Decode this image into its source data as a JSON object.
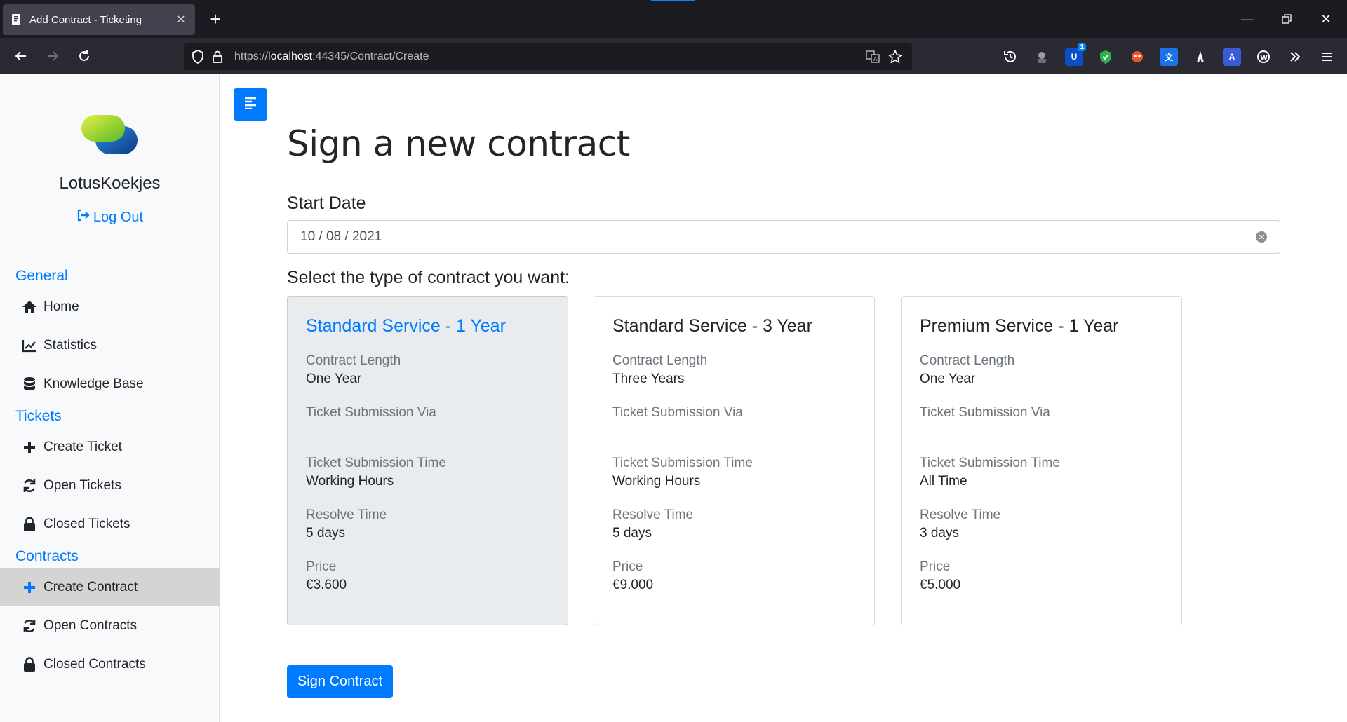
{
  "browser": {
    "tab_title": "Add Contract - Ticketing",
    "url_prefix": "https://",
    "url_host": "localhost",
    "url_path": ":44345/Contract/Create",
    "extension_badge": "1"
  },
  "sidebar": {
    "brand": "LotusKoekjes",
    "logout": "Log Out",
    "sections": {
      "general": "General",
      "tickets": "Tickets",
      "contracts": "Contracts"
    },
    "items": {
      "home": "Home",
      "statistics": "Statistics",
      "knowledge_base": "Knowledge Base",
      "create_ticket": "Create Ticket",
      "open_tickets": "Open Tickets",
      "closed_tickets": "Closed Tickets",
      "create_contract": "Create Contract",
      "open_contracts": "Open Contracts",
      "closed_contracts": "Closed Contracts"
    },
    "active_item": "create_contract"
  },
  "main": {
    "heading": "Sign a new contract",
    "start_date_label": "Start Date",
    "start_date_value": "10 / 08 / 2021",
    "select_label": "Select the type of contract you want:",
    "sign_button": "Sign Contract"
  },
  "field_labels": {
    "length": "Contract Length",
    "via": "Ticket Submission Via",
    "time": "Ticket Submission Time",
    "resolve": "Resolve Time",
    "price": "Price"
  },
  "contracts": [
    {
      "title": "Standard Service - 1 Year",
      "length": "One Year",
      "via": "",
      "time": "Working Hours",
      "resolve": "5 days",
      "price": "€3.600",
      "selected": true
    },
    {
      "title": "Standard Service - 3 Year",
      "length": "Three Years",
      "via": "",
      "time": "Working Hours",
      "resolve": "5 days",
      "price": "€9.000",
      "selected": false
    },
    {
      "title": "Premium Service - 1 Year",
      "length": "One Year",
      "via": "",
      "time": "All Time",
      "resolve": "3 days",
      "price": "€5.000",
      "selected": false
    }
  ],
  "colors": {
    "accent": "#007bff",
    "chrome_dark": "#1c1b22",
    "sidebar_bg": "#f8f9fa",
    "active_item_bg": "#d4d4d4",
    "selected_card_bg": "#e9ecef"
  }
}
